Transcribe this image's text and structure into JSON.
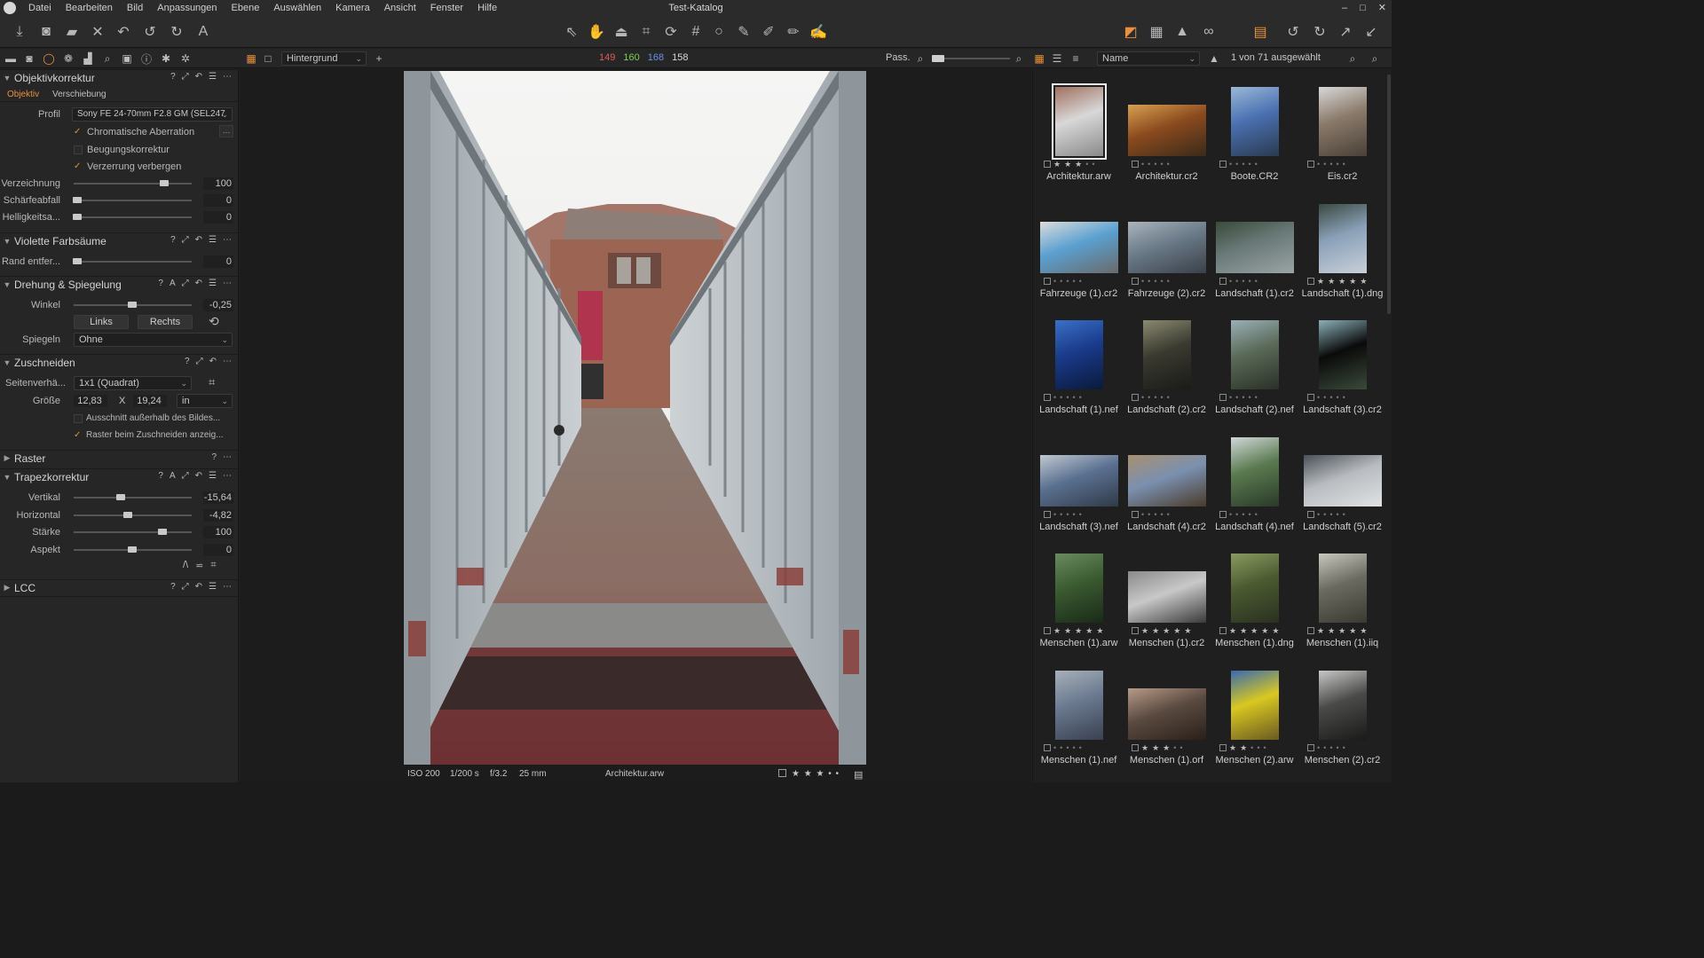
{
  "window": {
    "title": "Test-Katalog",
    "controls": [
      "–",
      "□",
      "✕"
    ]
  },
  "menu": [
    "Datei",
    "Bearbeiten",
    "Bild",
    "Anpassungen",
    "Ebene",
    "Auswählen",
    "Kamera",
    "Ansicht",
    "Fenster",
    "Hilfe"
  ],
  "subbar": {
    "layer_select": "Hintergrund",
    "rgb": {
      "r": "149",
      "g": "160",
      "b": "168",
      "l": "158"
    },
    "zoom_label": "Pass.",
    "sort_select": "Name",
    "selection_count": "1 von 71 ausgewählt"
  },
  "lens": {
    "title": "Objektivkorrektur",
    "tabs": [
      "Objektiv",
      "Verschiebung"
    ],
    "profile_label": "Profil",
    "profile_value": "Sony FE 24-70mm F2.8 GM (SEL247",
    "chromatic": "Chromatische Aberration",
    "diffraction": "Beugungskorrektur",
    "hide_distortion": "Verzerrung verbergen",
    "sliders": [
      {
        "label": "Verzeichnung",
        "value": "100",
        "pos": 0.8
      },
      {
        "label": "Schärfeabfall",
        "value": "0",
        "pos": 0.0
      },
      {
        "label": "Helligkeitsa...",
        "value": "0",
        "pos": 0.0
      }
    ]
  },
  "purple": {
    "title": "Violette Farbsäume",
    "label": "Rand entfer...",
    "value": "0",
    "pos": 0.0
  },
  "rotation": {
    "title": "Drehung & Spiegelung",
    "angle_label": "Winkel",
    "angle_value": "-0,25",
    "pos": 0.49,
    "left_btn": "Links",
    "right_btn": "Rechts",
    "mirror_label": "Spiegeln",
    "mirror_value": "Ohne"
  },
  "crop": {
    "title": "Zuschneiden",
    "ratio_label": "Seitenverhä...",
    "ratio_value": "1x1 (Quadrat)",
    "size_label": "Größe",
    "width": "12,83",
    "x": "X",
    "height": "19,24",
    "unit": "in",
    "outside": "Ausschnitt außerhalb des Bildes...",
    "grid": "Raster beim Zuschneiden anzeig..."
  },
  "grid_section": {
    "title": "Raster"
  },
  "keystone": {
    "title": "Trapezkorrektur",
    "sliders": [
      {
        "label": "Vertikal",
        "value": "-15,64",
        "pos": 0.4
      },
      {
        "label": "Horizontal",
        "value": "-4,82",
        "pos": 0.46
      },
      {
        "label": "Stärke",
        "value": "100",
        "pos": 0.78
      },
      {
        "label": "Aspekt",
        "value": "0",
        "pos": 0.5
      }
    ]
  },
  "lcc": {
    "title": "LCC"
  },
  "viewer": {
    "iso": "ISO 200",
    "shutter": "1/200 s",
    "aperture": "f/3.2",
    "focal": "25 mm",
    "filename": "Architektur.arw",
    "stars": "★ ★ ★ • •"
  },
  "thumbnails": [
    {
      "name": "Architektur.arw",
      "rating": 3,
      "kind": "bridge",
      "orient": "p",
      "sel": true
    },
    {
      "name": "Architektur.cr2",
      "rating": 0,
      "kind": "library",
      "orient": "l"
    },
    {
      "name": "Boote.CR2",
      "rating": 0,
      "kind": "boat",
      "orient": "p"
    },
    {
      "name": "Eis.cr2",
      "rating": 0,
      "kind": "ice",
      "orient": "p"
    },
    {
      "name": "Fahrzeuge (1).cr2",
      "rating": 0,
      "kind": "van",
      "orient": "l"
    },
    {
      "name": "Fahrzeuge (2).cr2",
      "rating": 0,
      "kind": "car",
      "orient": "l"
    },
    {
      "name": "Landschaft (1).cr2",
      "rating": 0,
      "kind": "hills",
      "orient": "l"
    },
    {
      "name": "Landschaft (1).dng",
      "rating": 5,
      "kind": "river",
      "orient": "p"
    },
    {
      "name": "Landschaft (1).nef",
      "rating": 0,
      "kind": "lake",
      "orient": "p"
    },
    {
      "name": "Landschaft (2).cr2",
      "rating": 0,
      "kind": "forest",
      "orient": "p"
    },
    {
      "name": "Landschaft (2).nef",
      "rating": 0,
      "kind": "cliff",
      "orient": "p"
    },
    {
      "name": "Landschaft (3).cr2",
      "rating": 0,
      "kind": "cave",
      "orient": "p"
    },
    {
      "name": "Landschaft (3).nef",
      "rating": 0,
      "kind": "mountain",
      "orient": "l"
    },
    {
      "name": "Landschaft (4).cr2",
      "rating": 0,
      "kind": "rails",
      "orient": "l"
    },
    {
      "name": "Landschaft (4).nef",
      "rating": 0,
      "kind": "valley",
      "orient": "p"
    },
    {
      "name": "Landschaft (5).cr2",
      "rating": 0,
      "kind": "snow",
      "orient": "l"
    },
    {
      "name": "Menschen (1).arw",
      "rating": 5,
      "kind": "person-green",
      "orient": "p"
    },
    {
      "name": "Menschen (1).cr2",
      "rating": 5,
      "kind": "bike",
      "orient": "l"
    },
    {
      "name": "Menschen (1).dng",
      "rating": 5,
      "kind": "tree",
      "orient": "p"
    },
    {
      "name": "Menschen (1).iiq",
      "rating": 5,
      "kind": "person-white",
      "orient": "p"
    },
    {
      "name": "Menschen (1).nef",
      "rating": 0,
      "kind": "person-blue",
      "orient": "p"
    },
    {
      "name": "Menschen (1).orf",
      "rating": 3,
      "kind": "face",
      "orient": "l"
    },
    {
      "name": "Menschen (2).arw",
      "rating": 2,
      "kind": "yellow",
      "orient": "p"
    },
    {
      "name": "Menschen (2).cr2",
      "rating": 0,
      "kind": "person-dark",
      "orient": "p"
    }
  ],
  "colors": {
    "accent": "#e8913a",
    "panel": "#262626",
    "bg": "#1c1c1c"
  }
}
